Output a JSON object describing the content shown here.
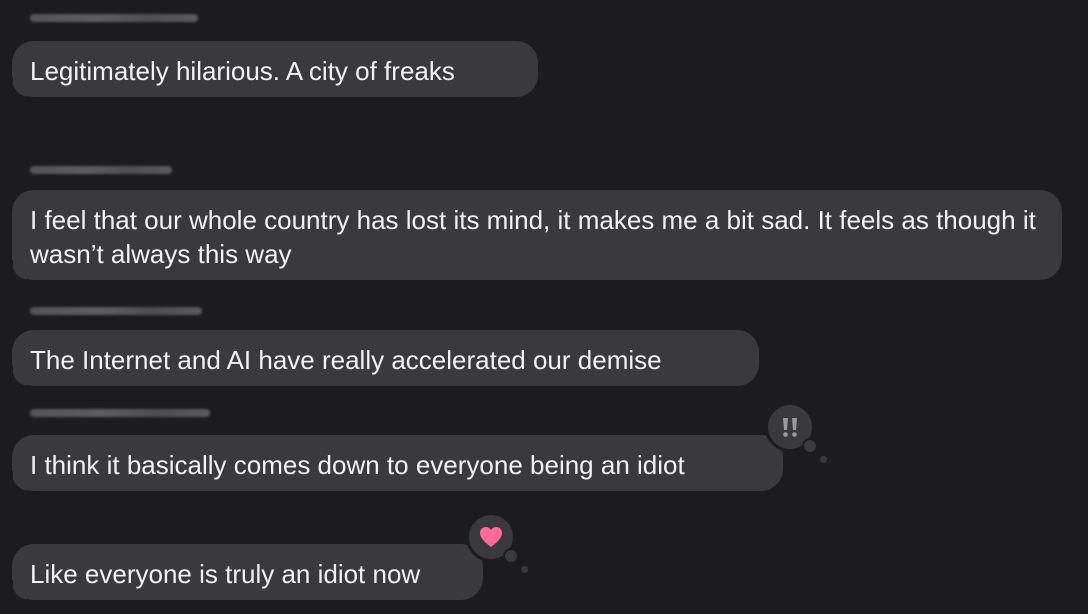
{
  "messages": [
    {
      "text": "Legitimately hilarious. A city of freaks"
    },
    {
      "text": "I feel that our whole country has lost its mind, it makes me a bit sad. It feels as though it wasn’t always this way"
    },
    {
      "text": "The Internet and AI have really accelerated our demise"
    },
    {
      "text": "I think it basically comes down to everyone being an idiot",
      "tapback": "exclamation-icon"
    },
    {
      "text": "Like everyone is truly an idiot now",
      "tapback": "heart-icon"
    }
  ],
  "colors": {
    "background": "#1c1c1e",
    "bubble": "#3a3a3c",
    "text": "#f2f2f7",
    "heart": "#ff6b9a",
    "exclamation": "#9a9a9e"
  }
}
